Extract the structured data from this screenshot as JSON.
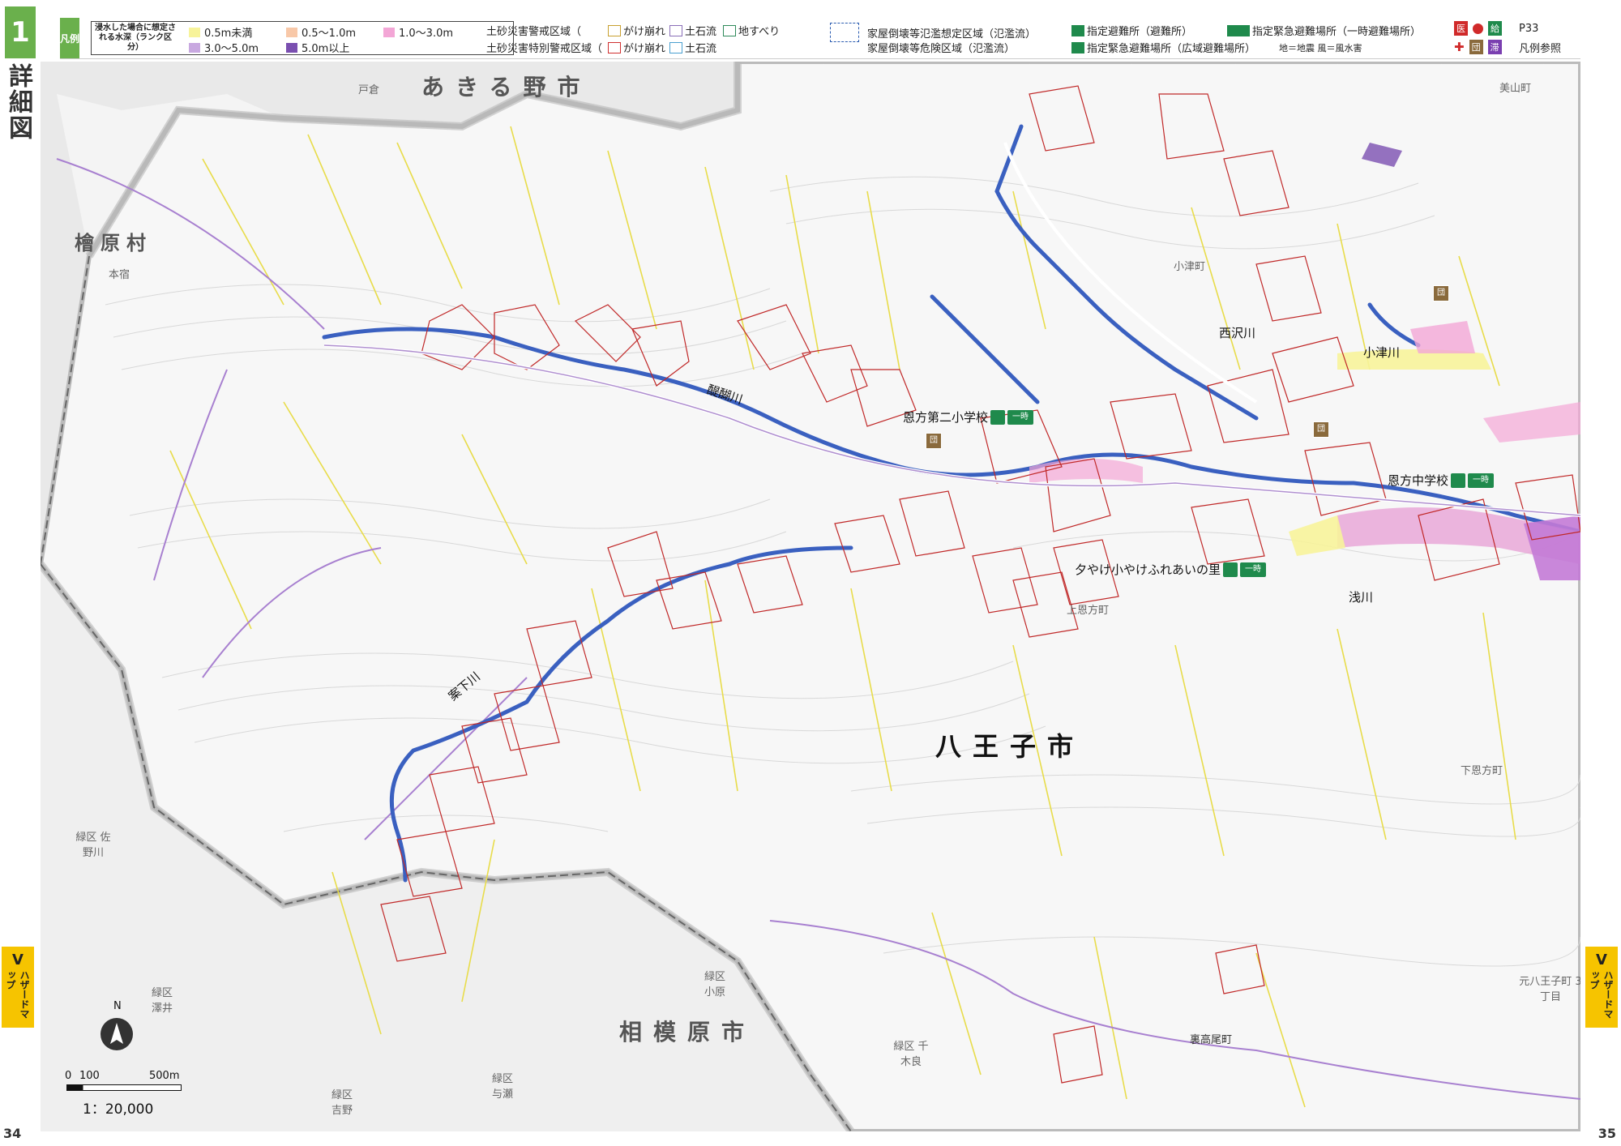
{
  "page": {
    "section_number": "1",
    "section_title": "詳細図",
    "hazard_tab": {
      "letter": "V",
      "text": "ハザードマップ"
    },
    "page_left": "34",
    "page_right": "35"
  },
  "legend": {
    "tag": "凡例",
    "depth_title": "浸水した場合に想定される水深（ランク区分）",
    "depth_ranks": [
      {
        "label": "0.5m未満",
        "color": "#f7f39a"
      },
      {
        "label": "0.5〜1.0m",
        "color": "#f8c8a8"
      },
      {
        "label": "1.0〜3.0m",
        "color": "#f3a6d6"
      },
      {
        "label": "3.0〜5.0m",
        "color": "#c8a8e0"
      },
      {
        "label": "5.0m以上",
        "color": "#7a4fb0"
      }
    ],
    "sediment_warning": "土砂災害警戒区域（",
    "sediment_special": "土砂災害特別警戒区域（",
    "cliff": "がけ崩れ",
    "debris": "土石流",
    "landslide": "地すべり",
    "flood_house_1": "家屋倒壊等氾濫想定区域（氾濫流）",
    "flood_house_2": "家屋倒壊等危険区域（氾濫流）",
    "shelter": "指定避難所（避難所）",
    "emergency_temp": "指定緊急避難場所（一時避難場所）",
    "emergency_wide": "指定緊急避難場所（広域避難場所）",
    "quake_note": "地＝地震 風＝風水害",
    "ref_page": "P33",
    "ref_text": "凡例参照",
    "icon_labels": [
      "医",
      "給",
      "団",
      "滞"
    ]
  },
  "map": {
    "cities": [
      "あきる野市",
      "檜原村",
      "八王子市",
      "相模原市"
    ],
    "places": [
      "戸倉",
      "本宿",
      "美山町",
      "小津町",
      "上恩方町",
      "下恩方町",
      "緑区 佐野川",
      "緑区 澤井",
      "緑区 小原",
      "緑区 吉野",
      "緑区 与瀬",
      "緑区 千木良",
      "裏高尾町",
      "元八王子町 3丁目"
    ],
    "rivers": [
      "醍醐川",
      "案下川",
      "西沢川",
      "小津川",
      "浅川"
    ],
    "facilities": [
      {
        "name": "恩方第二小学校",
        "badge": "一時"
      },
      {
        "name": "恩方中学校",
        "badge": "一時"
      },
      {
        "name": "夕やけ小やけふれあいの里",
        "badge": "一時"
      }
    ],
    "scale_labels": {
      "zero": "0",
      "mid": "100",
      "end": "500m",
      "ratio": "1：20,000",
      "north": "N"
    }
  }
}
